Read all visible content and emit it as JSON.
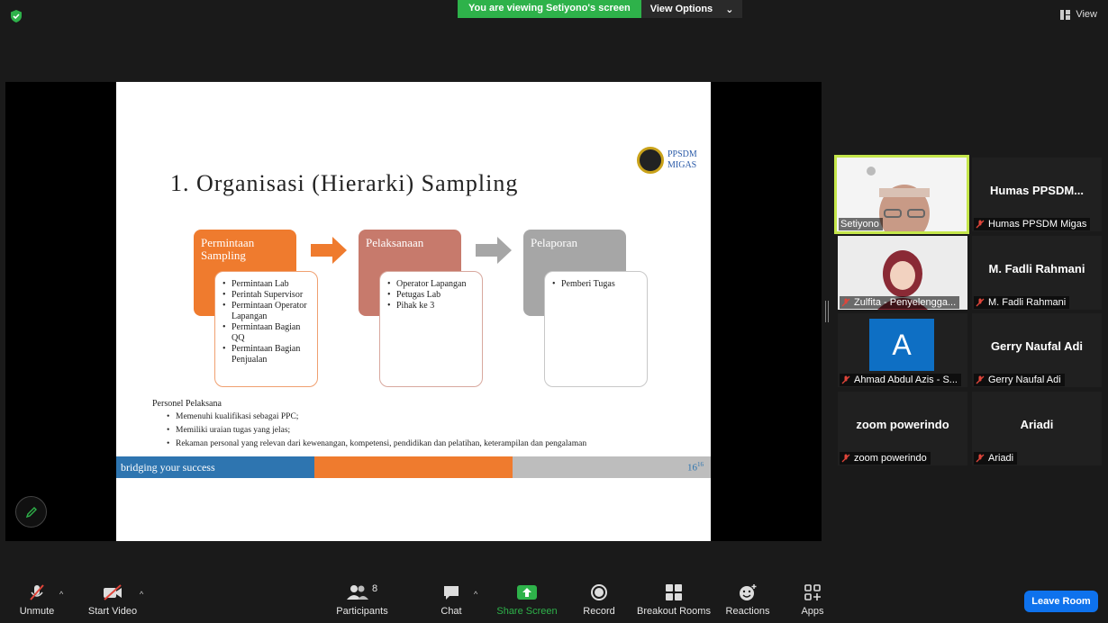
{
  "banner": {
    "viewing_text": "You are viewing Setiyono's screen",
    "view_options_label": "View Options"
  },
  "view_button_label": "View",
  "slide": {
    "title": "1. Organisasi (Hierarki) Sampling",
    "logo_line1": "PPSDM",
    "logo_line2": "MIGAS",
    "boxes": [
      {
        "title": "Permintaan Sampling",
        "items": [
          "Permintaan Lab",
          "Perintah Supervisor",
          "Permintaan Operator Lapangan",
          "Permintaan Bagian QQ",
          "Permintaan Bagian Penjualan"
        ]
      },
      {
        "title": "Pelaksanaan",
        "items": [
          "Operator Lapangan",
          "Petugas Lab",
          "Pihak ke 3"
        ]
      },
      {
        "title": "Pelaporan",
        "items": [
          "Pemberi Tugas"
        ]
      }
    ],
    "personel_heading": "Personel Pelaksana",
    "personel_items": [
      "Memenuhi kualifikasi sebagai PPC;",
      "Memiliki uraian tugas yang jelas;",
      "Rekaman personal yang relevan dari kewenangan, kompetensi, pendidikan dan pelatihan, keterampilan dan pengalaman"
    ],
    "footer_tagline": "bridging your success",
    "page_number": "16",
    "page_sup": "16"
  },
  "participants": [
    {
      "name": "Setiyono",
      "label": "Setiyono",
      "video": true
    },
    {
      "name": "Humas PPSDM...",
      "label": "Humas PPSDM Migas",
      "video": false
    },
    {
      "name": "",
      "label": "Zulfita - Penyelengga...",
      "video": true
    },
    {
      "name": "M. Fadli Rahmani",
      "label": "M. Fadli Rahmani",
      "video": false
    },
    {
      "name": "A",
      "label": "Ahmad Abdul Azis - S...",
      "video": false
    },
    {
      "name": "Gerry Naufal Adi",
      "label": "Gerry Naufal Adi",
      "video": false
    },
    {
      "name": "zoom powerindo",
      "label": "zoom powerindo",
      "video": false
    },
    {
      "name": "Ariadi",
      "label": "Ariadi",
      "video": false
    }
  ],
  "toolbar": {
    "unmute": "Unmute",
    "start_video": "Start Video",
    "participants": "Participants",
    "participants_count": "8",
    "chat": "Chat",
    "share_screen": "Share Screen",
    "record": "Record",
    "breakout_rooms": "Breakout Rooms",
    "reactions": "Reactions",
    "apps": "Apps",
    "leave_room": "Leave Room"
  },
  "colors": {
    "accent_green": "#2eb24a",
    "box_orange": "#ef7b2e",
    "box_rose": "#c77a6c",
    "box_gray": "#a6a6a6",
    "leave_blue": "#0e72ed"
  }
}
